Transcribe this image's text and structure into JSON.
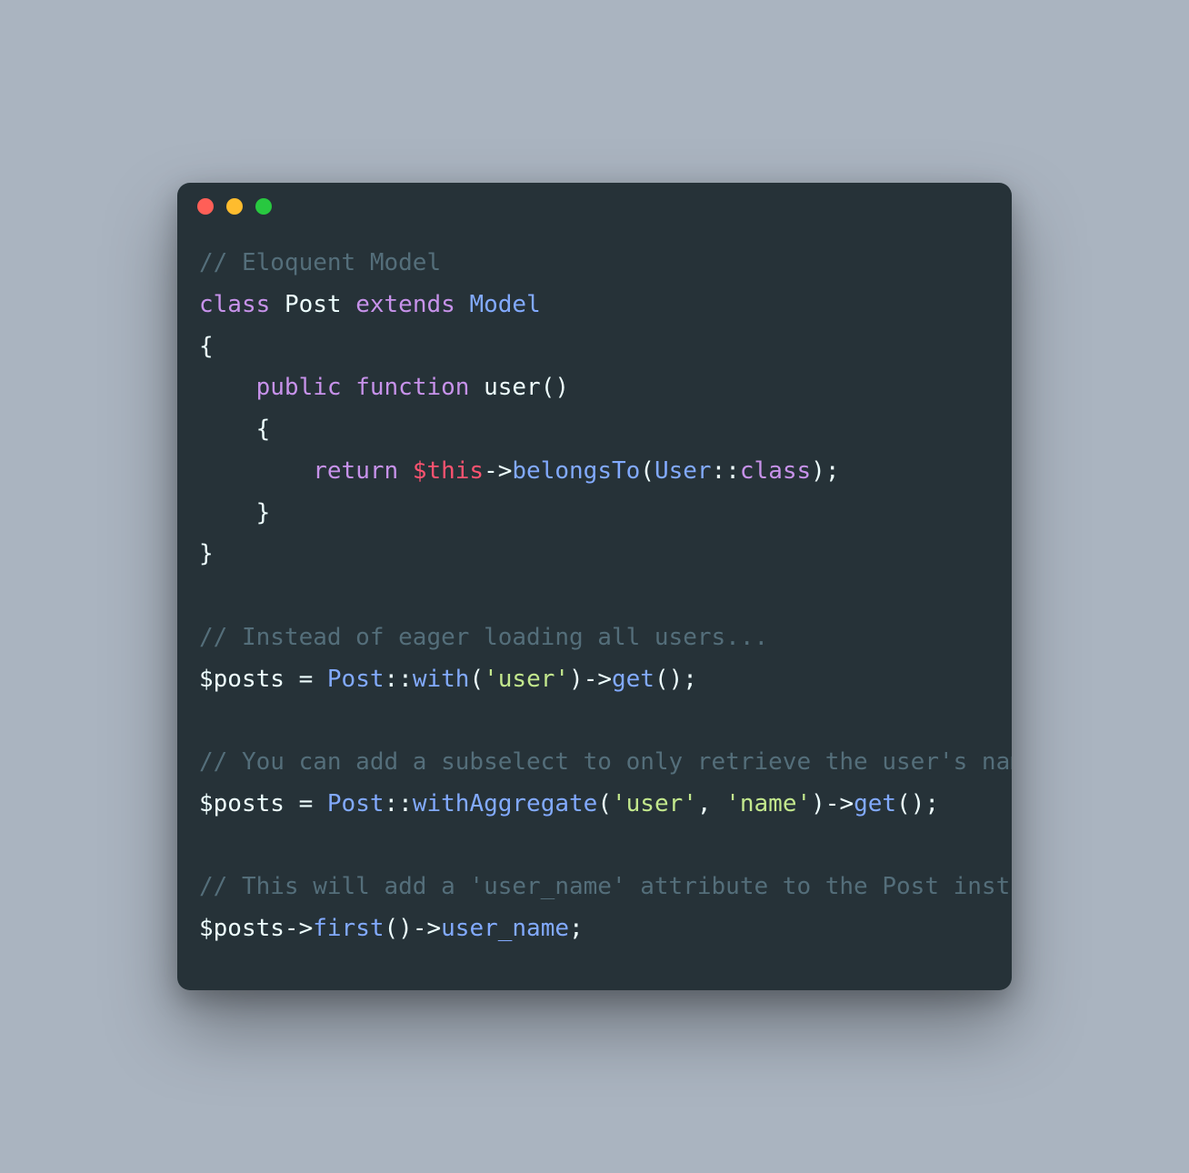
{
  "window": {
    "traffic_lights": {
      "red": "#ff5f57",
      "yellow": "#febc2e",
      "green": "#28c840"
    }
  },
  "code": {
    "c1": "// Eloquent Model",
    "kw_class": "class",
    "name_post": "Post",
    "kw_extends": "extends",
    "name_model": "Model",
    "brace_open": "{",
    "indent1": "    ",
    "kw_public": "public",
    "kw_function": "function",
    "fn_user": "user",
    "parens": "()",
    "indent2": "        ",
    "kw_return": "return",
    "this": "$this",
    "arrow": "->",
    "fn_belongsTo": "belongsTo",
    "paren_open": "(",
    "name_user": "User",
    "dcolon": "::",
    "kw_class_const": "class",
    "paren_close_semi": ");",
    "brace_close": "}",
    "c2": "// Instead of eager loading all users...",
    "var_posts": "$posts",
    "eq": " = ",
    "fn_with": "with",
    "str_user": "'user'",
    "paren_close": ")",
    "fn_get": "get",
    "empty_parens_semi": "();",
    "c3": "// You can add a subselect to only retrieve the user's name...",
    "fn_withAggregate": "withAggregate",
    "comma_sp": ", ",
    "str_name": "'name'",
    "c4": "// This will add a 'user_name' attribute to the Post instance:",
    "fn_first": "first",
    "empty_parens": "()",
    "prop_user_name": "user_name",
    "semi": ";"
  }
}
